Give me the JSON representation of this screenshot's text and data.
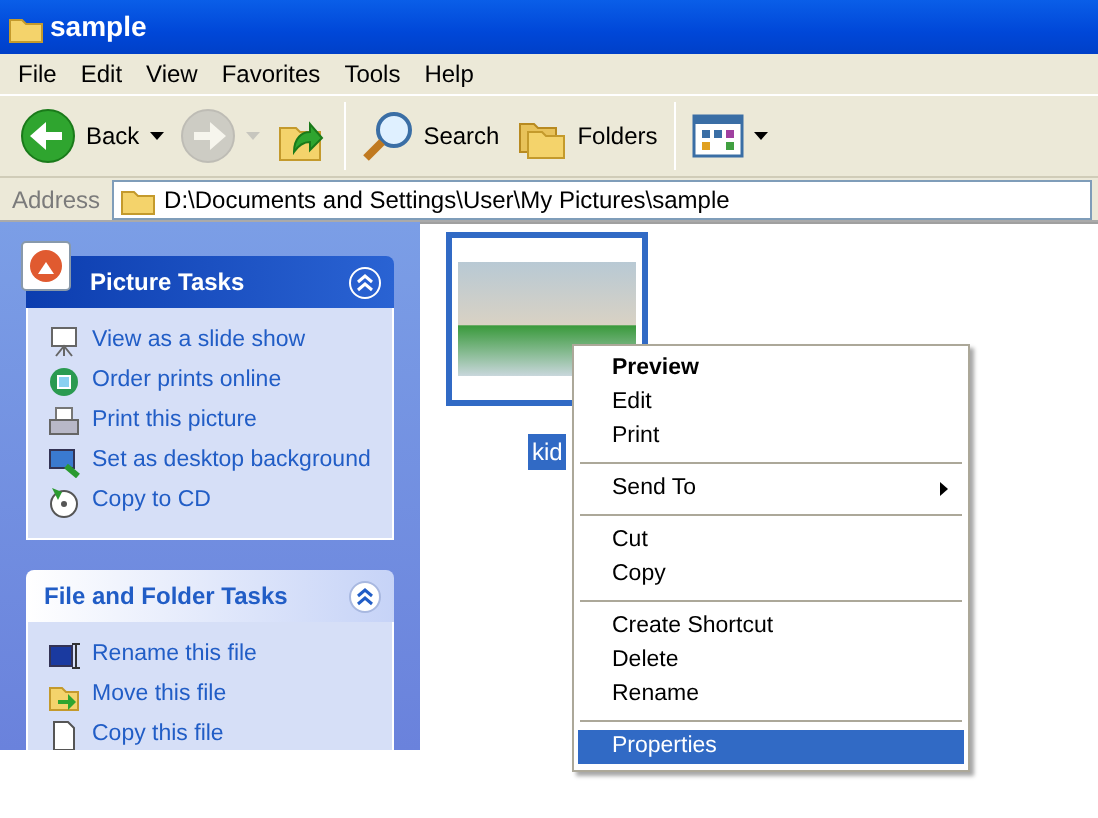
{
  "window": {
    "title": "sample"
  },
  "menu_bar": [
    "File",
    "Edit",
    "View",
    "Favorites",
    "Tools",
    "Help"
  ],
  "toolbar": [
    {
      "kind": "back",
      "label": "Back",
      "disabled": false
    },
    {
      "kind": "forward",
      "disabled": true
    },
    {
      "kind": "up"
    },
    {
      "kind": "search",
      "label": "Search"
    },
    {
      "kind": "folders",
      "label": "Folders"
    },
    {
      "kind": "views"
    }
  ],
  "address_bar": {
    "label": "Address",
    "value": "D:\\Documents and Settings\\User\\My Pictures\\sample"
  },
  "sidebar": {
    "panels": [
      {
        "title": "Picture Tasks",
        "kind": "primary",
        "expanded": true,
        "items": [
          "View as a slide show",
          "Order prints online",
          "Print this picture",
          "Set as desktop background",
          "Copy to CD"
        ]
      },
      {
        "title": "File and Folder Tasks",
        "kind": "normal",
        "expanded": true,
        "items": [
          "Rename this file",
          "Move this file",
          "Copy this file"
        ]
      }
    ]
  },
  "files": [
    {
      "name": "kid",
      "selected": true
    }
  ],
  "context_menu": [
    {
      "kind": "item",
      "label": "Preview",
      "default": true,
      "selected": false
    },
    {
      "kind": "item",
      "label": "Edit",
      "default": false,
      "selected": false
    },
    {
      "kind": "item",
      "label": "Print",
      "default": false,
      "selected": false
    },
    {
      "kind": "separator"
    },
    {
      "kind": "submenu",
      "label": "Send To",
      "default": false,
      "selected": false
    },
    {
      "kind": "separator"
    },
    {
      "kind": "item",
      "label": "Cut",
      "default": false,
      "selected": false
    },
    {
      "kind": "item",
      "label": "Copy",
      "default": false,
      "selected": false
    },
    {
      "kind": "separator"
    },
    {
      "kind": "item",
      "label": "Create Shortcut",
      "default": false,
      "selected": false
    },
    {
      "kind": "item",
      "label": "Delete",
      "default": false,
      "selected": false
    },
    {
      "kind": "item",
      "label": "Rename",
      "default": false,
      "selected": false
    },
    {
      "kind": "separator"
    },
    {
      "kind": "item",
      "label": "Properties",
      "default": false,
      "selected": true
    }
  ]
}
